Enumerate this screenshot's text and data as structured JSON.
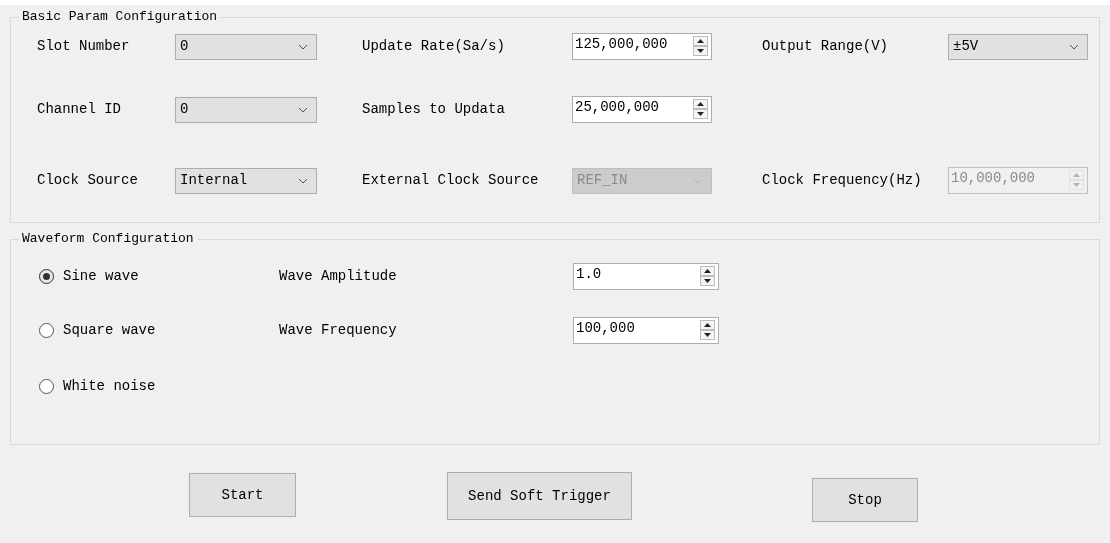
{
  "basic_param": {
    "title": "Basic Param Configuration",
    "rows": [
      {
        "fields": [
          {
            "label": "Slot Number",
            "control": {
              "kind": "combo",
              "value": "0",
              "disabled": false
            }
          },
          {
            "label": "Update Rate(Sa/s)",
            "control": {
              "kind": "spin",
              "value": "125,000,000",
              "disabled": false
            }
          },
          {
            "label": "Output Range(V)",
            "control": {
              "kind": "combo",
              "value": "±5V",
              "disabled": false
            }
          }
        ]
      },
      {
        "fields": [
          {
            "label": "Channel ID",
            "control": {
              "kind": "combo",
              "value": "0",
              "disabled": false
            }
          },
          {
            "label": "Samples to Updata",
            "control": {
              "kind": "spin",
              "value": "25,000,000",
              "disabled": false
            }
          }
        ]
      },
      {
        "fields": [
          {
            "label": "Clock Source",
            "control": {
              "kind": "combo",
              "value": "Internal",
              "disabled": false
            }
          },
          {
            "label": "External Clock Source",
            "control": {
              "kind": "combo",
              "value": "REF_IN",
              "disabled": true
            }
          },
          {
            "label": "Clock Frequency(Hz)",
            "control": {
              "kind": "spin",
              "value": "10,000,000",
              "disabled": true
            }
          }
        ]
      }
    ]
  },
  "waveform": {
    "title": "Waveform Configuration",
    "wave_types": [
      {
        "label": "Sine wave",
        "selected": true
      },
      {
        "label": "Square wave",
        "selected": false
      },
      {
        "label": "White noise",
        "selected": false
      }
    ],
    "params": [
      {
        "label": "Wave Amplitude",
        "value": "1.0"
      },
      {
        "label": "Wave Frequency",
        "value": "100,000"
      }
    ]
  },
  "buttons": [
    "Start",
    "Send Soft Trigger",
    "Stop"
  ]
}
